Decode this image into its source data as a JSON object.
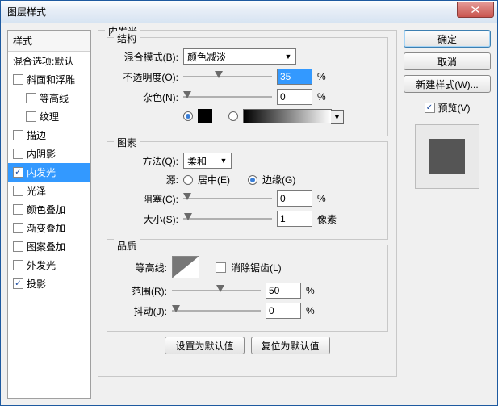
{
  "window": {
    "title": "图层样式"
  },
  "styles": {
    "header": "样式",
    "blend_default": "混合选项:默认",
    "items": [
      {
        "label": "斜面和浮雕",
        "checked": false,
        "indent": false
      },
      {
        "label": "等高线",
        "checked": false,
        "indent": true
      },
      {
        "label": "纹理",
        "checked": false,
        "indent": true
      },
      {
        "label": "描边",
        "checked": false,
        "indent": false
      },
      {
        "label": "内阴影",
        "checked": false,
        "indent": false
      },
      {
        "label": "内发光",
        "checked": true,
        "indent": false,
        "selected": true
      },
      {
        "label": "光泽",
        "checked": false,
        "indent": false
      },
      {
        "label": "颜色叠加",
        "checked": false,
        "indent": false
      },
      {
        "label": "渐变叠加",
        "checked": false,
        "indent": false
      },
      {
        "label": "图案叠加",
        "checked": false,
        "indent": false
      },
      {
        "label": "外发光",
        "checked": false,
        "indent": false
      },
      {
        "label": "投影",
        "checked": true,
        "indent": false
      }
    ]
  },
  "panel": {
    "title": "内发光",
    "structure": {
      "legend": "结构",
      "blend_mode_label": "混合模式(B):",
      "blend_mode_value": "颜色减淡",
      "opacity_label": "不透明度(O):",
      "opacity_value": "35",
      "opacity_unit": "%",
      "noise_label": "杂色(N):",
      "noise_value": "0",
      "noise_unit": "%"
    },
    "elements": {
      "legend": "图素",
      "method_label": "方法(Q):",
      "method_value": "柔和",
      "source_label": "源:",
      "source_center": "居中(E)",
      "source_edge": "边缘(G)",
      "choke_label": "阻塞(C):",
      "choke_value": "0",
      "choke_unit": "%",
      "size_label": "大小(S):",
      "size_value": "1",
      "size_unit": "像素"
    },
    "quality": {
      "legend": "品质",
      "contour_label": "等高线:",
      "antialias_label": "消除锯齿(L)",
      "range_label": "范围(R):",
      "range_value": "50",
      "range_unit": "%",
      "jitter_label": "抖动(J):",
      "jitter_value": "0",
      "jitter_unit": "%"
    },
    "buttons": {
      "make_default": "设置为默认值",
      "reset_default": "复位为默认值"
    }
  },
  "right": {
    "ok": "确定",
    "cancel": "取消",
    "new_style": "新建样式(W)...",
    "preview": "预览(V)"
  }
}
